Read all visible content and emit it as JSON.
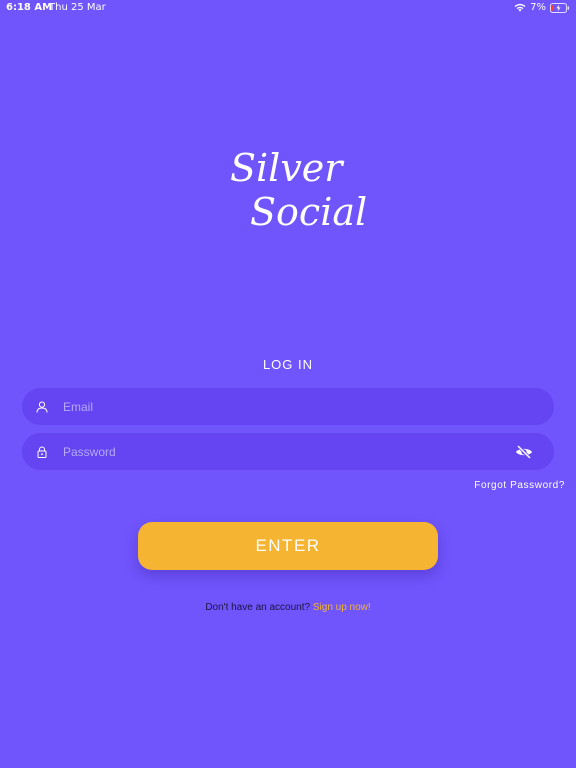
{
  "status_bar": {
    "time": "6:18 AM",
    "date": "Thu 25 Mar",
    "battery_percent": "7%",
    "wifi_icon": "wifi-icon",
    "battery_icon": "battery-charging-icon"
  },
  "logo": {
    "line1": "Silver",
    "line2": "Social"
  },
  "login": {
    "heading": "LOG IN",
    "email": {
      "placeholder": "Email",
      "value": "",
      "icon": "user-icon"
    },
    "password": {
      "placeholder": "Password",
      "value": "",
      "icon": "lock-icon",
      "toggle_icon": "eye-slash-icon"
    },
    "forgot_password": "Forgot Password?",
    "enter_label": "ENTER",
    "signup_prompt": "Don't have an account?",
    "signup_link": "Sign up now!"
  },
  "colors": {
    "background": "#6f55fb",
    "field_background": "#6445f1",
    "accent": "#f5b431",
    "text": "#ffffff",
    "dark_text": "#1b1340"
  }
}
